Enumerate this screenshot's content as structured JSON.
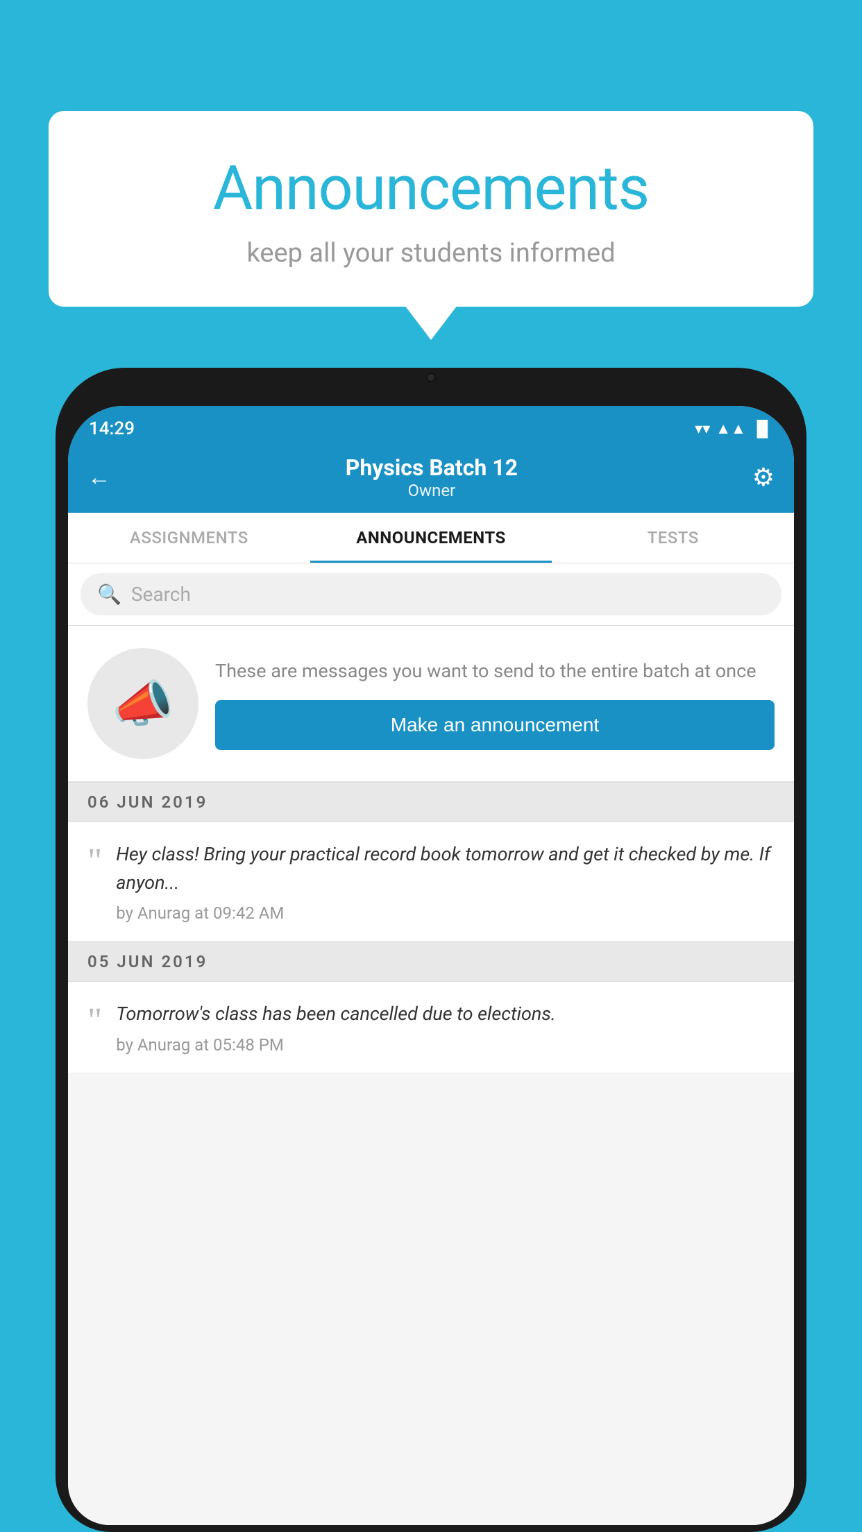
{
  "background_color": "#29b6d8",
  "speech_bubble": {
    "title": "Announcements",
    "subtitle": "keep all your students informed"
  },
  "phone": {
    "status_bar": {
      "time": "14:29",
      "wifi": "▼",
      "signal": "▲",
      "battery": "▐"
    },
    "header": {
      "title": "Physics Batch 12",
      "subtitle": "Owner",
      "back_label": "←",
      "gear_label": "⚙"
    },
    "tabs": [
      {
        "label": "ASSIGNMENTS",
        "active": false
      },
      {
        "label": "ANNOUNCEMENTS",
        "active": true
      },
      {
        "label": "TESTS",
        "active": false
      }
    ],
    "search": {
      "placeholder": "Search"
    },
    "promo": {
      "description": "These are messages you want to send to the entire batch at once",
      "button_label": "Make an announcement"
    },
    "announcements": [
      {
        "date": "06  JUN  2019",
        "text": "Hey class! Bring your practical record book tomorrow and get it checked by me. If anyon...",
        "meta": "by Anurag at 09:42 AM"
      },
      {
        "date": "05  JUN  2019",
        "text": "Tomorrow's class has been cancelled due to elections.",
        "meta": "by Anurag at 05:48 PM"
      }
    ]
  }
}
